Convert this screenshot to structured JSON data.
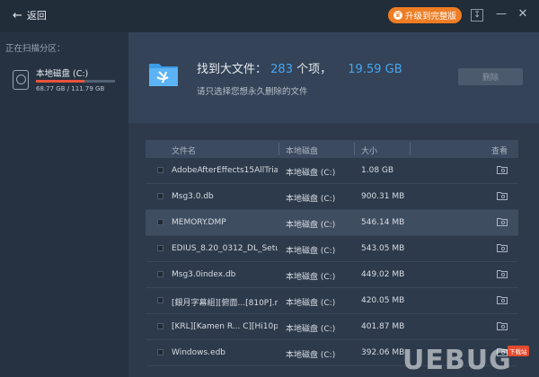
{
  "titlebar": {
    "back_label": "返回",
    "upgrade_label": "升级到完整版",
    "accent": "#ef7d23"
  },
  "sidebar": {
    "scan_title": "正在扫描分区：",
    "drive": {
      "name": "本地磁盘 (C:)",
      "usage_text": "68.77 GB / 111.79 GB",
      "used_fraction": 0.615,
      "bar_color": "#e8533b",
      "icon": "hard-disk-icon"
    }
  },
  "summary": {
    "prefix": "找到大文件：",
    "count": "283",
    "unit": "个项，",
    "total_size": "19.59 GB",
    "hint": "请只选择您想永久删除的文件",
    "delete_label": "删除",
    "highlight": "#45a7f2",
    "icon": "folder-broom-icon"
  },
  "table": {
    "headers": {
      "name": "文件名",
      "disk": "本地磁盘",
      "size": "大小",
      "view": "查看"
    },
    "rows": [
      {
        "name": "AdobeAfterEffects15AllTrial.zip",
        "disk": "本地磁盘 (C:)",
        "size": "1.08 GB",
        "selected": false
      },
      {
        "name": "Msg3.0.db",
        "disk": "本地磁盘 (C:)",
        "size": "900.31 MB",
        "selected": false
      },
      {
        "name": "MEMORY.DMP",
        "disk": "本地磁盘 (C:)",
        "size": "546.14 MB",
        "selected": true
      },
      {
        "name": "EDIUS_8.20_0312_DL_Setup.exe",
        "disk": "本地磁盘 (C:)",
        "size": "543.05 MB",
        "selected": false
      },
      {
        "name": "Msg3.0index.db",
        "disk": "本地磁盘 (C:)",
        "size": "449.02 MB",
        "selected": false
      },
      {
        "name": "[銀月字幕組][俯面...[810P].mp4",
        "disk": "本地磁盘 (C:)",
        "size": "420.05 MB",
        "selected": false
      },
      {
        "name": "[KRL][Kamen R... C][Hi10p].mp4",
        "disk": "本地磁盘 (C:)",
        "size": "401.87 MB",
        "selected": false
      },
      {
        "name": "Windows.edb",
        "disk": "本地磁盘 (C:)",
        "size": "392.06 MB",
        "selected": false
      }
    ]
  },
  "watermark": {
    "text": "UEBUG",
    "badge": "下载站"
  }
}
